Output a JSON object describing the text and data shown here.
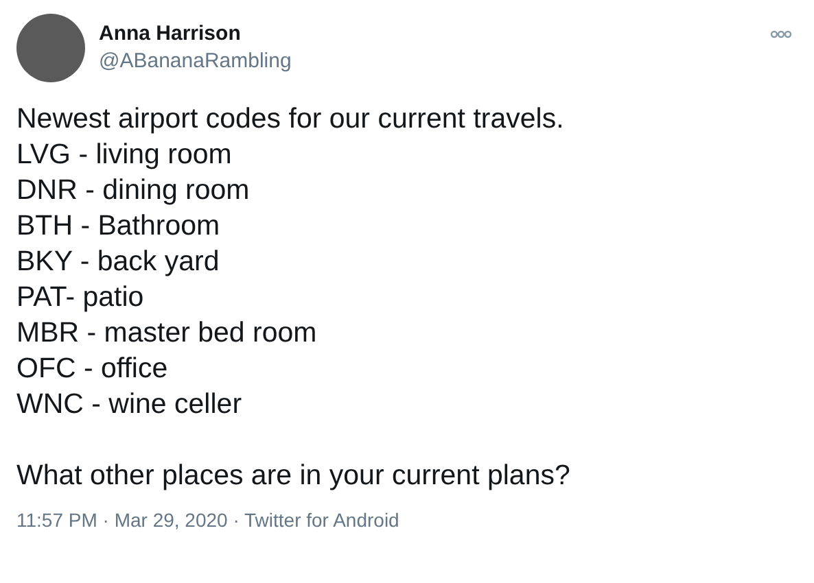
{
  "tweet": {
    "author": {
      "name": "Anna Harrison",
      "handle": "@ABananaRambling"
    },
    "lines": [
      "Newest airport codes for our current travels.",
      "LVG - living room",
      "DNR - dining room",
      "BTH - Bathroom",
      "BKY - back yard",
      "PAT- patio",
      "MBR - master bed room",
      "OFC - office",
      "WNC - wine celler"
    ],
    "question": "What other places are in your current plans?",
    "meta": "11:57 PM · Mar 29, 2020 · Twitter for Android"
  }
}
